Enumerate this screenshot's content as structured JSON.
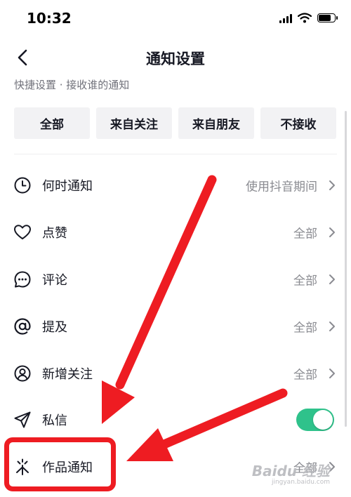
{
  "status_bar": {
    "time": "10:32"
  },
  "header": {
    "title": "通知设置"
  },
  "quick_settings": {
    "label": "快捷设置 · 接收谁的通知",
    "options": [
      "全部",
      "来自关注",
      "来自朋友",
      "不接收"
    ]
  },
  "settings": [
    {
      "icon": "clock-icon",
      "label": "何时通知",
      "value": "使用抖音期间"
    },
    {
      "icon": "heart-icon",
      "label": "点赞",
      "value": "全部"
    },
    {
      "icon": "comment-icon",
      "label": "评论",
      "value": "全部"
    },
    {
      "icon": "at-icon",
      "label": "提及",
      "value": "全部"
    },
    {
      "icon": "person-icon",
      "label": "新增关注",
      "value": "全部"
    },
    {
      "icon": "send-icon",
      "label": "私信",
      "toggle_on": true
    },
    {
      "icon": "sparkle-icon",
      "label": "作品通知",
      "value": "全部"
    }
  ],
  "annotation_color": "#ee1c22",
  "toggle_color": "#2fc28b",
  "watermark": {
    "main": "Baidu 经验",
    "sub": "jingyan.baidu.com"
  }
}
